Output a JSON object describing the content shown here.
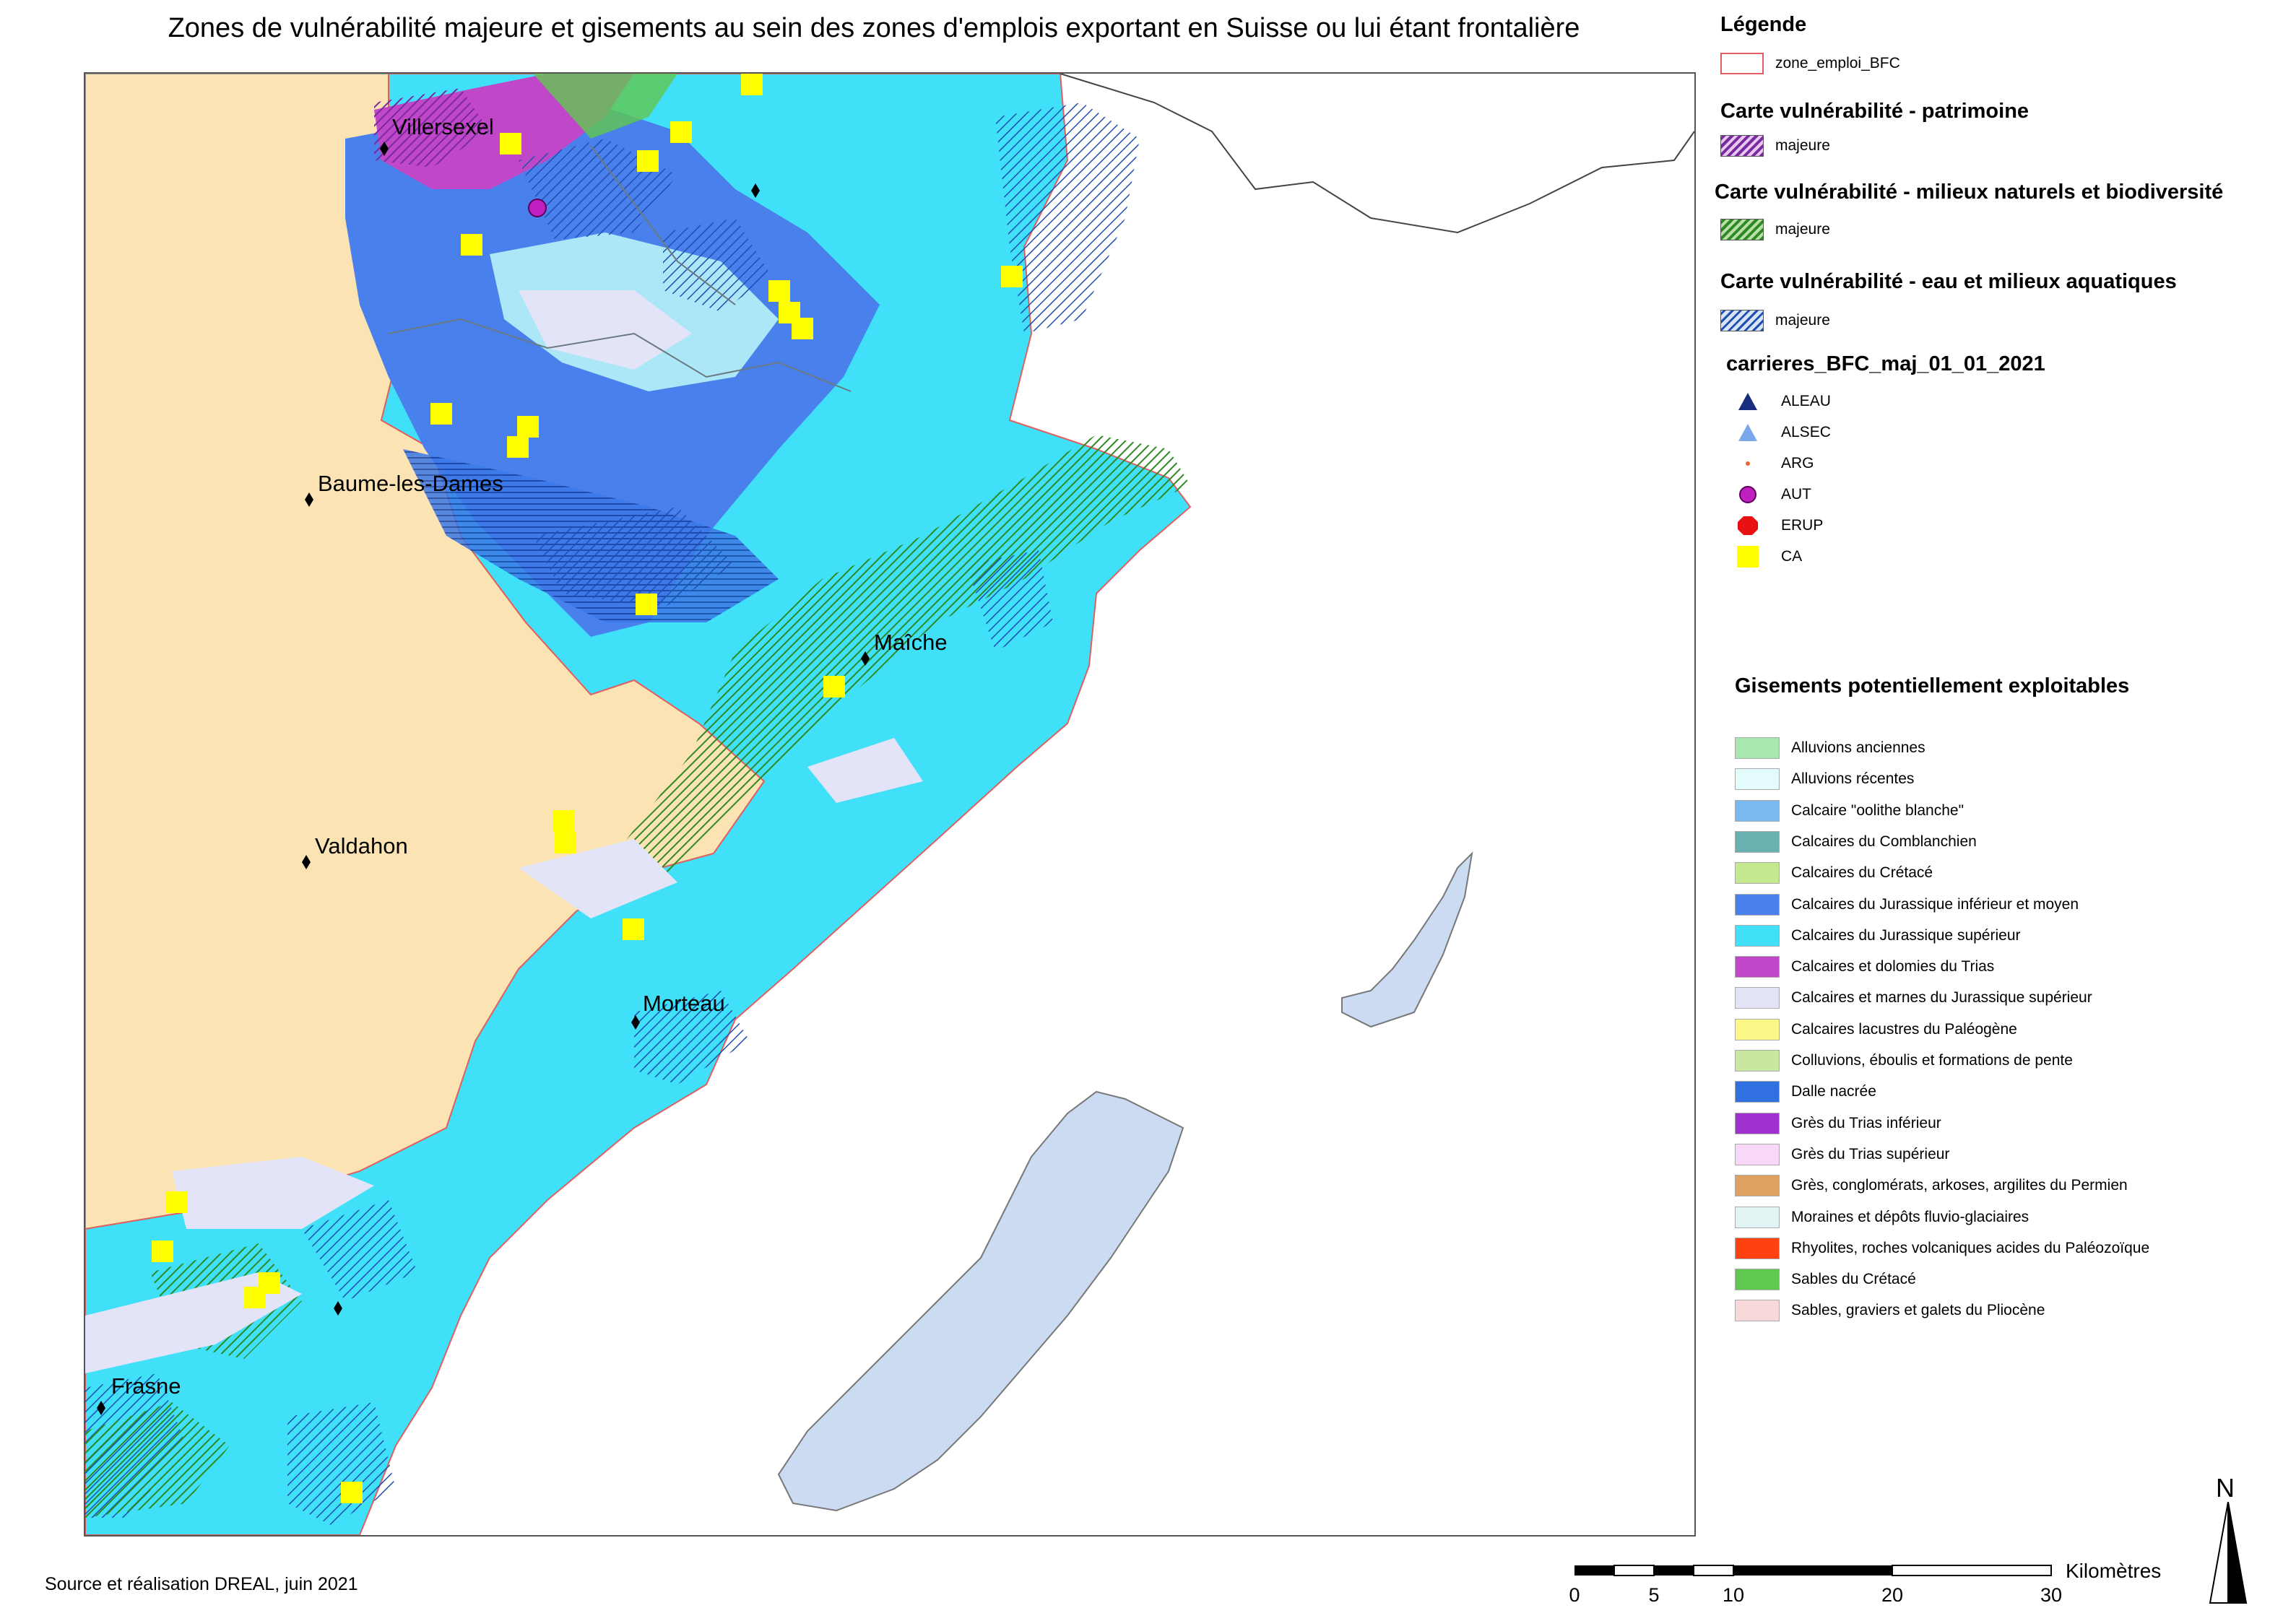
{
  "title": "Zones de vulnérabilité majeure et gisements au sein des zones d'emplois exportant en Suisse ou lui étant frontalière",
  "source": "Source et réalisation DREAL, juin 2021",
  "cities": [
    {
      "name": "Villersexel"
    },
    {
      "name": "Baume-les-Dames"
    },
    {
      "name": "Maîche"
    },
    {
      "name": "Valdahon"
    },
    {
      "name": "Morteau"
    },
    {
      "name": "Frasne"
    }
  ],
  "legend": {
    "heading": "Légende",
    "zone": {
      "label": "zone_emploi_BFC",
      "color": "#e06060"
    },
    "patrimoine": {
      "title": "Carte vulnérabilité - patrimoine",
      "label": "majeure",
      "color": "#8b2fb0"
    },
    "milieux": {
      "title": "Carte vulnérabilité - milieux naturels et biodiversité",
      "label": "majeure",
      "color": "#3a9a2a"
    },
    "eau": {
      "title": "Carte vulnérabilité - eau et milieux aquatiques",
      "label": "majeure",
      "color": "#2a5fb8"
    },
    "carrieres": {
      "title": "carrieres_BFC_maj_01_01_2021",
      "items": [
        {
          "label": "ALEAU",
          "icon": "triangle",
          "color": "#1a2e80"
        },
        {
          "label": "ALSEC",
          "icon": "triangle",
          "color": "#7aa8ea"
        },
        {
          "label": "ARG",
          "icon": "dot",
          "color": "#e06a2a"
        },
        {
          "label": "AUT",
          "icon": "circle",
          "color": "#c020c0"
        },
        {
          "label": "ERUP",
          "icon": "octagon",
          "color": "#e81010"
        },
        {
          "label": "CA",
          "icon": "square",
          "color": "#ffff00"
        }
      ]
    },
    "gisements": {
      "title": "Gisements potentiellement exploitables",
      "items": [
        {
          "label": "Alluvions anciennes",
          "color": "#a8e8b0"
        },
        {
          "label": "Alluvions récentes",
          "color": "#e4fbfb"
        },
        {
          "label": "Calcaire \"oolithe blanche\"",
          "color": "#7ab8f0"
        },
        {
          "label": "Calcaires du Comblanchien",
          "color": "#6ab0b0"
        },
        {
          "label": "Calcaires du Crétacé",
          "color": "#c4e890"
        },
        {
          "label": "Calcaires du Jurassique inférieur et moyen",
          "color": "#4a80ec"
        },
        {
          "label": "Calcaires du Jurassique supérieur",
          "color": "#40e0f8"
        },
        {
          "label": "Calcaires et dolomies du Trias",
          "color": "#c048c8"
        },
        {
          "label": "Calcaires et marnes du Jurassique supérieur",
          "color": "#e4e4f8"
        },
        {
          "label": "Calcaires lacustres du Paléogène",
          "color": "#fcf888"
        },
        {
          "label": "Colluvions, éboulis et formations de pente",
          "color": "#c8e8a0"
        },
        {
          "label": "Dalle nacrée",
          "color": "#3070e0"
        },
        {
          "label": "Grès du Trias inférieur",
          "color": "#a030d0"
        },
        {
          "label": "Grès du Trias supérieur",
          "color": "#f8d8f8"
        },
        {
          "label": "Grès, conglomérats, arkoses, argilites du Permien",
          "color": "#e0a060"
        },
        {
          "label": "Moraines et dépôts fluvio-glaciaires",
          "color": "#e0f4f4"
        },
        {
          "label": "Rhyolites, roches volcaniques acides du Paléozoïque",
          "color": "#ff4010"
        },
        {
          "label": "Sables du Crétacé",
          "color": "#60c850"
        },
        {
          "label": "Sables, graviers et galets du Pliocène",
          "color": "#f8d8d8"
        }
      ]
    }
  },
  "scale": {
    "unit": "Kilomètres",
    "ticks": [
      "0",
      "5",
      "10",
      "20",
      "30"
    ]
  },
  "north": "N"
}
